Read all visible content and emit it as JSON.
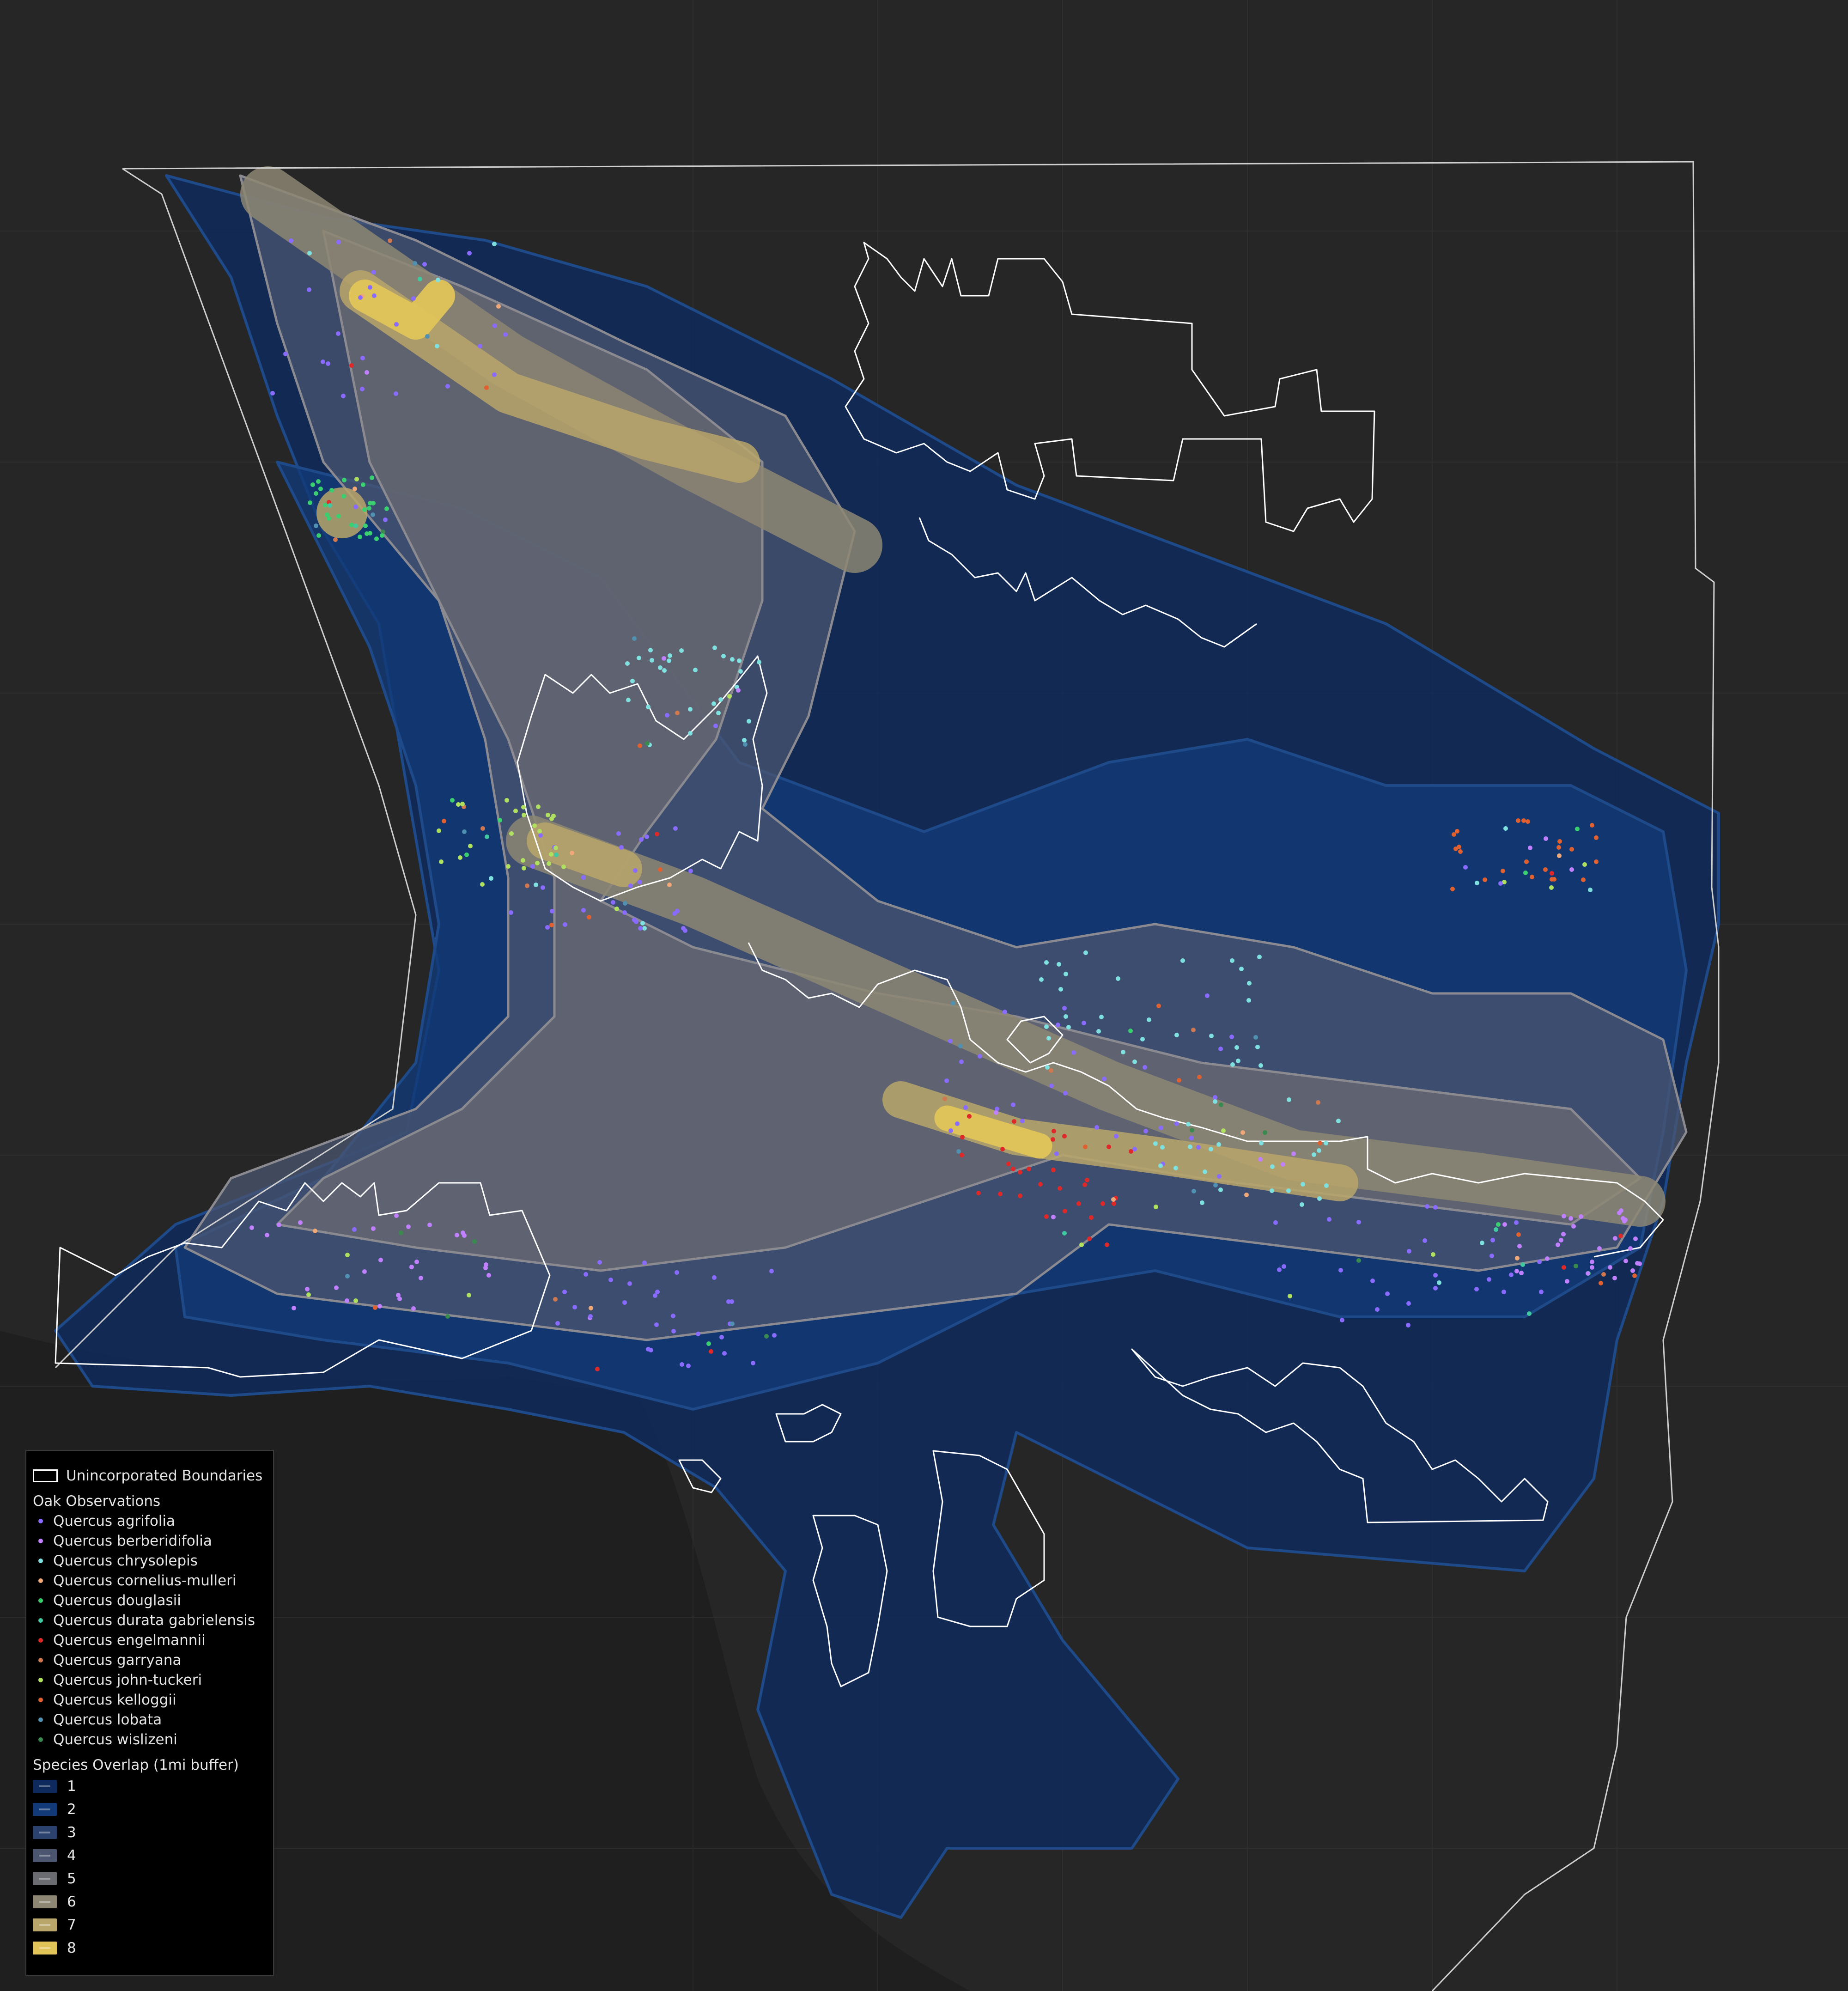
{
  "legend": {
    "boundary_label": "Unincorporated Boundaries",
    "observations_title": "Oak Observations",
    "species": [
      {
        "name": "Quercus agrifolia",
        "color": "#8a6bff"
      },
      {
        "name": "Quercus berberidifolia",
        "color": "#c080ff"
      },
      {
        "name": "Quercus chrysolepis",
        "color": "#7fe0e0"
      },
      {
        "name": "Quercus cornelius-mulleri",
        "color": "#f0a878"
      },
      {
        "name": "Quercus douglasii",
        "color": "#3ad070"
      },
      {
        "name": "Quercus durata gabrielensis",
        "color": "#40c8a0"
      },
      {
        "name": "Quercus engelmannii",
        "color": "#e02828"
      },
      {
        "name": "Quercus garryana",
        "color": "#d07850"
      },
      {
        "name": "Quercus john-tuckeri",
        "color": "#b0e060"
      },
      {
        "name": "Quercus kelloggii",
        "color": "#e06030"
      },
      {
        "name": "Quercus lobata",
        "color": "#5090b0"
      },
      {
        "name": "Quercus wislizeni",
        "color": "#3a8a50"
      }
    ],
    "overlap_title": "Species Overlap (1mi buffer)",
    "overlap_levels": [
      {
        "label": "1",
        "color": "#0e2a5c"
      },
      {
        "label": "2",
        "color": "#123a78"
      },
      {
        "label": "3",
        "color": "#2c426e"
      },
      {
        "label": "4",
        "color": "#4b5570"
      },
      {
        "label": "5",
        "color": "#6b6b72"
      },
      {
        "label": "6",
        "color": "#8c8673"
      },
      {
        "label": "7",
        "color": "#b8a66a"
      },
      {
        "label": "8",
        "color": "#e0c45a"
      }
    ]
  },
  "colors": {
    "background": "#262626",
    "county_outline": "#cfcfcf",
    "boundary_outline": "#ffffff"
  }
}
